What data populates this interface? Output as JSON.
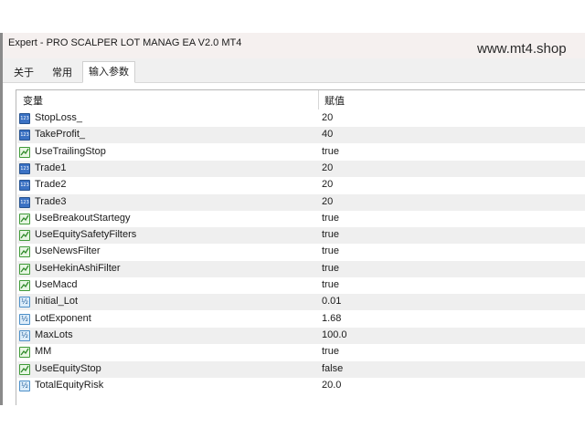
{
  "window": {
    "title": "Expert - PRO SCALPER LOT MANAG EA V2.0 MT4",
    "watermark": "www.mt4.shop"
  },
  "tabs": [
    {
      "label": "关于"
    },
    {
      "label": "常用"
    },
    {
      "label": "输入参数",
      "active": true
    }
  ],
  "table": {
    "headers": {
      "variable": "变量",
      "value": "赋值"
    },
    "rows": [
      {
        "name": "StopLoss_",
        "value": "20",
        "icon": "int-icon"
      },
      {
        "name": "TakeProfit_",
        "value": "40",
        "icon": "int-icon"
      },
      {
        "name": "UseTrailingStop",
        "value": "true",
        "icon": "bool-icon"
      },
      {
        "name": "Trade1",
        "value": "20",
        "icon": "int-icon"
      },
      {
        "name": "Trade2",
        "value": "20",
        "icon": "int-icon"
      },
      {
        "name": "Trade3",
        "value": "20",
        "icon": "int-icon"
      },
      {
        "name": "UseBreakoutStartegy",
        "value": "true",
        "icon": "bool-icon"
      },
      {
        "name": "UseEquitySafetyFilters",
        "value": "true",
        "icon": "bool-icon"
      },
      {
        "name": "UseNewsFilter",
        "value": "true",
        "icon": "bool-icon"
      },
      {
        "name": "UseHekinAshiFilter",
        "value": "true",
        "icon": "bool-icon"
      },
      {
        "name": "UseMacd",
        "value": "true",
        "icon": "bool-icon"
      },
      {
        "name": "Initial_Lot",
        "value": "0.01",
        "icon": "dbl-icon"
      },
      {
        "name": "LotExponent",
        "value": "1.68",
        "icon": "dbl-icon"
      },
      {
        "name": "MaxLots",
        "value": "100.0",
        "icon": "dbl-icon"
      },
      {
        "name": "MM",
        "value": "true",
        "icon": "bool-icon"
      },
      {
        "name": "UseEquityStop",
        "value": "false",
        "icon": "bool-icon"
      },
      {
        "name": "TotalEquityRisk",
        "value": "20.0",
        "icon": "dbl-icon"
      }
    ]
  }
}
